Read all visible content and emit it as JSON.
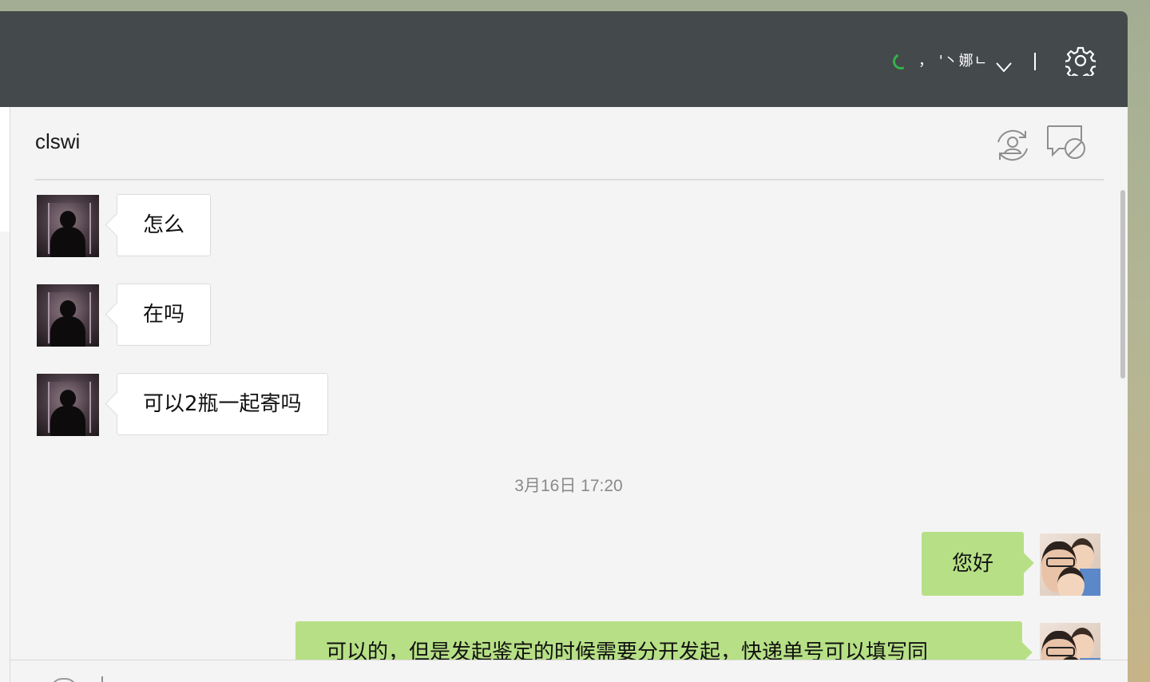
{
  "topbar": {
    "account_name": "， '丶娜ㄴ",
    "status_icon": "loading-spinner-icon",
    "dropdown_icon": "chevron-down-icon",
    "settings_icon": "gear-icon"
  },
  "chat": {
    "title": "clswi",
    "header_icons": [
      "contact-sync-icon",
      "block-chat-icon"
    ]
  },
  "messages": [
    {
      "direction": "in",
      "text": "怎么"
    },
    {
      "direction": "in",
      "text": "在吗"
    },
    {
      "direction": "in",
      "text": "可以2瓶一起寄吗"
    },
    {
      "type": "timestamp",
      "text": "3月16日 17:20"
    },
    {
      "direction": "out",
      "text": "您好"
    },
    {
      "direction": "out",
      "text": "可以的，但是发起鉴定的时候需要分开发起，快递单号可以填写同"
    }
  ],
  "colors": {
    "topbar": "#444a4c",
    "chat_background": "#f4f4f4",
    "outgoing_bubble": "#b7e086",
    "incoming_bubble": "#ffffff",
    "status_green": "#36b24a"
  }
}
